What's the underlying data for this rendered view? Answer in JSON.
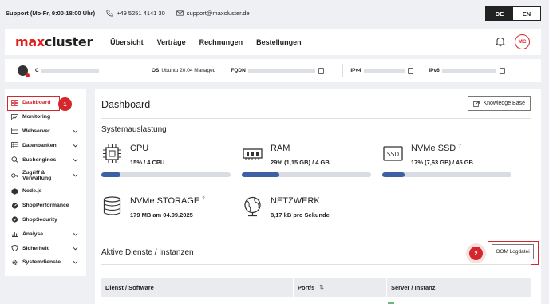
{
  "topbar": {
    "support": "Support (Mo-Fr, 9:00-18:00 Uhr)",
    "phone": "+49 5251 4141 30",
    "email": "support@maxcluster.de",
    "lang_de": "DE",
    "lang_en": "EN"
  },
  "navbar": {
    "logo_max": "max",
    "logo_cluster": "cluster",
    "links": [
      "Übersicht",
      "Verträge",
      "Rechnungen",
      "Bestellungen"
    ],
    "avatar": "MC"
  },
  "infobar": {
    "c_prefix": "C",
    "os_key": "OS",
    "os_value": "Ubuntu 20.04 Managed",
    "fqdn_key": "FQDN",
    "ipv4_key": "IPv4",
    "ipv6_key": "IPv6"
  },
  "sidebar": {
    "items": [
      {
        "label": "Dashboard",
        "icon": "dashboard-icon",
        "chevron": false
      },
      {
        "label": "Monitoring",
        "icon": "monitoring-icon",
        "chevron": false
      },
      {
        "label": "Webserver",
        "icon": "webserver-icon",
        "chevron": true
      },
      {
        "label": "Datenbanken",
        "icon": "database-icon",
        "chevron": true
      },
      {
        "label": "Suchengines",
        "icon": "search-icon",
        "chevron": true
      },
      {
        "label": "Zugriff & Verwaltung",
        "icon": "key-icon",
        "chevron": true
      },
      {
        "label": "Node.js",
        "icon": "nodejs-icon",
        "chevron": false
      },
      {
        "label": "ShopPerformance",
        "icon": "performance-icon",
        "chevron": false
      },
      {
        "label": "ShopSecurity",
        "icon": "security-icon",
        "chevron": false
      },
      {
        "label": "Analyse",
        "icon": "analyse-icon",
        "chevron": true
      },
      {
        "label": "Sicherheit",
        "icon": "shield-icon",
        "chevron": true
      },
      {
        "label": "Systemdienste",
        "icon": "gear-icon",
        "chevron": true
      }
    ]
  },
  "badges": {
    "one": "1",
    "two": "2"
  },
  "main": {
    "title": "Dashboard",
    "kb_button": "Knowledge Base",
    "system_label": "Systemauslastung",
    "metrics": [
      {
        "title": "CPU",
        "value": "15% / 4 CPU",
        "fill": 0.15,
        "info": false
      },
      {
        "title": "RAM",
        "value": "29% (1,15 GB) / 4 GB",
        "fill": 0.29,
        "info": false
      },
      {
        "title": "NVMe SSD",
        "value": "17% (7,63 GB) / 45 GB",
        "fill": 0.17,
        "info": true
      },
      {
        "title": "NVMe STORAGE",
        "value": "179 MB am 04.09.2025",
        "info": true
      },
      {
        "title": "NETZWERK",
        "value": "8,17 kB pro Sekunde",
        "info": false
      }
    ],
    "services_label": "Aktive Dienste / Instanzen",
    "oom_button": "OOM Logdatei",
    "table_headers": [
      "Dienst / Software",
      "Port/s",
      "Server / Instanz"
    ]
  },
  "colors": {
    "accent": "#d3262d",
    "bar_fill": "#3d5fa3",
    "bar_track": "#d9dde3"
  }
}
